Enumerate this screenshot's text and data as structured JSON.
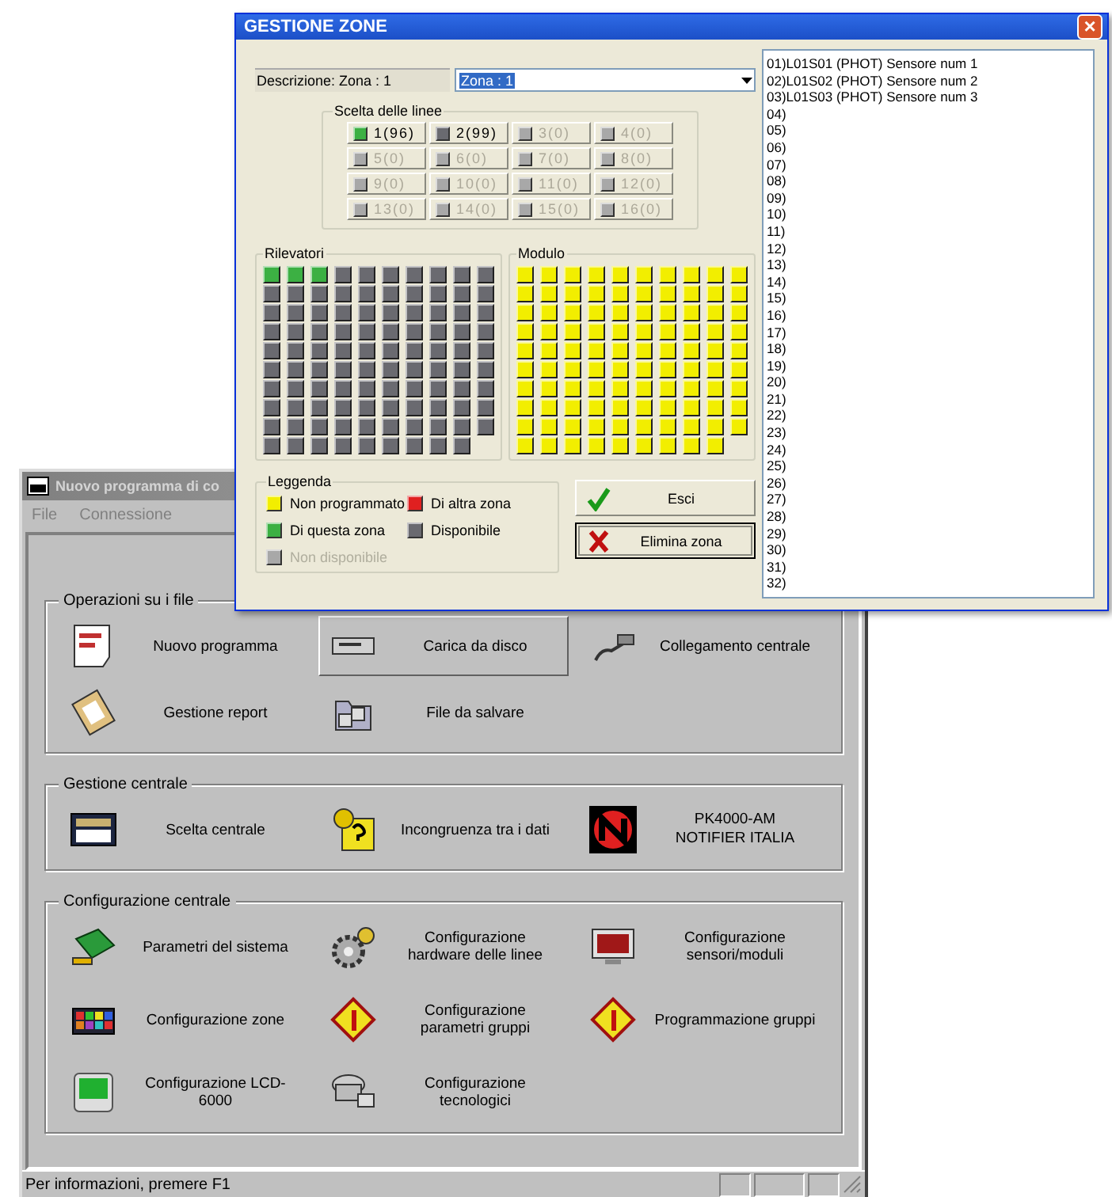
{
  "main_window": {
    "title": "Nuovo programma di co",
    "menu": [
      {
        "label": "File",
        "disabled": true
      },
      {
        "label": "Connessione",
        "disabled": true
      }
    ],
    "groups": [
      {
        "title": "Operazioni su i file",
        "items": [
          {
            "label": "Nuovo programma",
            "selected": false
          },
          {
            "label": "Carica da disco",
            "selected": true
          },
          {
            "label": "Collegamento centrale",
            "selected": false
          },
          {
            "label": "Gestione report",
            "selected": false
          },
          {
            "label": "File da salvare",
            "selected": false
          }
        ]
      },
      {
        "title": "Gestione centrale",
        "items": [
          {
            "label": "Scelta centrale",
            "selected": false
          },
          {
            "label": "Incongruenza tra i dati",
            "selected": false
          }
        ],
        "panel_model": [
          "PK4000-AM",
          "NOTIFIER ITALIA"
        ]
      },
      {
        "title": "Configurazione centrale",
        "items": [
          {
            "label": "Parametri del sistema",
            "selected": false
          },
          {
            "label": "Configurazione hardware delle linee",
            "selected": false
          },
          {
            "label": "Configurazione sensori/moduli",
            "selected": false
          },
          {
            "label": "Configurazione zone",
            "selected": false
          },
          {
            "label": "Configurazione parametri gruppi",
            "selected": false
          },
          {
            "label": "Programmazione gruppi",
            "selected": false
          },
          {
            "label": "Configurazione LCD-6000",
            "selected": false
          },
          {
            "label": "Configurazione tecnologici",
            "selected": false
          }
        ]
      }
    ],
    "status_bar": {
      "text": "Per informazioni, premere F1"
    }
  },
  "dialog": {
    "title": "GESTIONE ZONE",
    "close": "×",
    "description_label": "Descrizione: Zona : 1",
    "zone_select": {
      "value": "Zona : 1"
    },
    "lines_group": {
      "title": "Scelta delle linee",
      "lines": [
        {
          "label": "1(96)",
          "selected": true,
          "disabled": false
        },
        {
          "label": "2(99)",
          "selected": false,
          "disabled": false
        },
        {
          "label": "3(0)",
          "selected": false,
          "disabled": true
        },
        {
          "label": "4(0)",
          "selected": false,
          "disabled": true
        },
        {
          "label": "5(0)",
          "selected": false,
          "disabled": true
        },
        {
          "label": "6(0)",
          "selected": false,
          "disabled": true
        },
        {
          "label": "7(0)",
          "selected": false,
          "disabled": true
        },
        {
          "label": "8(0)",
          "selected": false,
          "disabled": true
        },
        {
          "label": "9(0)",
          "selected": false,
          "disabled": true
        },
        {
          "label": "10(0)",
          "selected": false,
          "disabled": true
        },
        {
          "label": "11(0)",
          "selected": false,
          "disabled": true
        },
        {
          "label": "12(0)",
          "selected": false,
          "disabled": true
        },
        {
          "label": "13(0)",
          "selected": false,
          "disabled": true
        },
        {
          "label": "14(0)",
          "selected": false,
          "disabled": true
        },
        {
          "label": "15(0)",
          "selected": false,
          "disabled": true
        },
        {
          "label": "16(0)",
          "selected": false,
          "disabled": true
        }
      ]
    },
    "detectors": {
      "title": "Rilevatori",
      "cells": [
        {
          "in_zone": true
        },
        {
          "in_zone": true
        },
        {
          "in_zone": true
        },
        {
          "in_zone": false
        },
        {
          "in_zone": false
        },
        {
          "in_zone": false
        },
        {
          "in_zone": false
        },
        {
          "in_zone": false
        },
        {
          "in_zone": false
        },
        {
          "in_zone": false
        },
        {
          "in_zone": false
        },
        {
          "in_zone": false
        },
        {
          "in_zone": false
        },
        {
          "in_zone": false
        },
        {
          "in_zone": false
        },
        {
          "in_zone": false
        },
        {
          "in_zone": false
        },
        {
          "in_zone": false
        },
        {
          "in_zone": false
        },
        {
          "in_zone": false
        },
        {
          "in_zone": false
        },
        {
          "in_zone": false
        },
        {
          "in_zone": false
        },
        {
          "in_zone": false
        },
        {
          "in_zone": false
        },
        {
          "in_zone": false
        },
        {
          "in_zone": false
        },
        {
          "in_zone": false
        },
        {
          "in_zone": false
        },
        {
          "in_zone": false
        },
        {
          "in_zone": false
        },
        {
          "in_zone": false
        },
        {
          "in_zone": false
        },
        {
          "in_zone": false
        },
        {
          "in_zone": false
        },
        {
          "in_zone": false
        },
        {
          "in_zone": false
        },
        {
          "in_zone": false
        },
        {
          "in_zone": false
        },
        {
          "in_zone": false
        },
        {
          "in_zone": false
        },
        {
          "in_zone": false
        },
        {
          "in_zone": false
        },
        {
          "in_zone": false
        },
        {
          "in_zone": false
        },
        {
          "in_zone": false
        },
        {
          "in_zone": false
        },
        {
          "in_zone": false
        },
        {
          "in_zone": false
        },
        {
          "in_zone": false
        },
        {
          "in_zone": false
        },
        {
          "in_zone": false
        },
        {
          "in_zone": false
        },
        {
          "in_zone": false
        },
        {
          "in_zone": false
        },
        {
          "in_zone": false
        },
        {
          "in_zone": false
        },
        {
          "in_zone": false
        },
        {
          "in_zone": false
        },
        {
          "in_zone": false
        },
        {
          "in_zone": false
        },
        {
          "in_zone": false
        },
        {
          "in_zone": false
        },
        {
          "in_zone": false
        },
        {
          "in_zone": false
        },
        {
          "in_zone": false
        },
        {
          "in_zone": false
        },
        {
          "in_zone": false
        },
        {
          "in_zone": false
        },
        {
          "in_zone": false
        },
        {
          "in_zone": false
        },
        {
          "in_zone": false
        },
        {
          "in_zone": false
        },
        {
          "in_zone": false
        },
        {
          "in_zone": false
        },
        {
          "in_zone": false
        },
        {
          "in_zone": false
        },
        {
          "in_zone": false
        },
        {
          "in_zone": false
        },
        {
          "in_zone": false
        },
        {
          "in_zone": false
        },
        {
          "in_zone": false
        },
        {
          "in_zone": false
        },
        {
          "in_zone": false
        },
        {
          "in_zone": false
        },
        {
          "in_zone": false
        },
        {
          "in_zone": false
        },
        {
          "in_zone": false
        },
        {
          "in_zone": false
        },
        {
          "in_zone": false
        },
        {
          "in_zone": false
        },
        {
          "in_zone": false
        },
        {
          "in_zone": false
        },
        {
          "in_zone": false
        },
        {
          "in_zone": false
        },
        {
          "in_zone": false
        },
        {
          "in_zone": false
        },
        {
          "in_zone": false
        },
        {
          "in_zone": false
        }
      ]
    },
    "modules": {
      "title": "Modulo",
      "cells": [
        {
          "programmed": false
        },
        {
          "programmed": false
        },
        {
          "programmed": false
        },
        {
          "programmed": false
        },
        {
          "programmed": false
        },
        {
          "programmed": false
        },
        {
          "programmed": false
        },
        {
          "programmed": false
        },
        {
          "programmed": false
        },
        {
          "programmed": false
        },
        {
          "programmed": false
        },
        {
          "programmed": false
        },
        {
          "programmed": false
        },
        {
          "programmed": false
        },
        {
          "programmed": false
        },
        {
          "programmed": false
        },
        {
          "programmed": false
        },
        {
          "programmed": false
        },
        {
          "programmed": false
        },
        {
          "programmed": false
        },
        {
          "programmed": false
        },
        {
          "programmed": false
        },
        {
          "programmed": false
        },
        {
          "programmed": false
        },
        {
          "programmed": false
        },
        {
          "programmed": false
        },
        {
          "programmed": false
        },
        {
          "programmed": false
        },
        {
          "programmed": false
        },
        {
          "programmed": false
        },
        {
          "programmed": false
        },
        {
          "programmed": false
        },
        {
          "programmed": false
        },
        {
          "programmed": false
        },
        {
          "programmed": false
        },
        {
          "programmed": false
        },
        {
          "programmed": false
        },
        {
          "programmed": false
        },
        {
          "programmed": false
        },
        {
          "programmed": false
        },
        {
          "programmed": false
        },
        {
          "programmed": false
        },
        {
          "programmed": false
        },
        {
          "programmed": false
        },
        {
          "programmed": false
        },
        {
          "programmed": false
        },
        {
          "programmed": false
        },
        {
          "programmed": false
        },
        {
          "programmed": false
        },
        {
          "programmed": false
        },
        {
          "programmed": false
        },
        {
          "programmed": false
        },
        {
          "programmed": false
        },
        {
          "programmed": false
        },
        {
          "programmed": false
        },
        {
          "programmed": false
        },
        {
          "programmed": false
        },
        {
          "programmed": false
        },
        {
          "programmed": false
        },
        {
          "programmed": false
        },
        {
          "programmed": false
        },
        {
          "programmed": false
        },
        {
          "programmed": false
        },
        {
          "programmed": false
        },
        {
          "programmed": false
        },
        {
          "programmed": false
        },
        {
          "programmed": false
        },
        {
          "programmed": false
        },
        {
          "programmed": false
        },
        {
          "programmed": false
        },
        {
          "programmed": false
        },
        {
          "programmed": false
        },
        {
          "programmed": false
        },
        {
          "programmed": false
        },
        {
          "programmed": false
        },
        {
          "programmed": false
        },
        {
          "programmed": false
        },
        {
          "programmed": false
        },
        {
          "programmed": false
        },
        {
          "programmed": false
        },
        {
          "programmed": false
        },
        {
          "programmed": false
        },
        {
          "programmed": false
        },
        {
          "programmed": false
        },
        {
          "programmed": false
        },
        {
          "programmed": false
        },
        {
          "programmed": false
        },
        {
          "programmed": false
        },
        {
          "programmed": false
        },
        {
          "programmed": false
        },
        {
          "programmed": false
        },
        {
          "programmed": false
        },
        {
          "programmed": false
        },
        {
          "programmed": false
        },
        {
          "programmed": false
        },
        {
          "programmed": false
        },
        {
          "programmed": false
        },
        {
          "programmed": false
        },
        {
          "programmed": false
        }
      ]
    },
    "legend": {
      "title": "Leggenda",
      "items": [
        {
          "label": "Non programmato",
          "color": "#f2ee00",
          "disabled": false
        },
        {
          "label": "Di altra zona",
          "color": "#e02020",
          "disabled": false
        },
        {
          "label": "Di questa zona",
          "color": "#3cb043",
          "disabled": false
        },
        {
          "label": "Disponibile",
          "color": "#6a6a70",
          "disabled": false
        },
        {
          "label": "Non disponibile",
          "color": "#a8a8a8",
          "disabled": true
        }
      ]
    },
    "buttons": [
      {
        "label": "Esci",
        "kind": "ok"
      },
      {
        "label": "Elimina zona",
        "kind": "delete"
      }
    ],
    "sensor_list": [
      "01)L01S01 (PHOT) Sensore num 1",
      "02)L01S02 (PHOT) Sensore num 2",
      "03)L01S03 (PHOT) Sensore num 3",
      "04)",
      "05)",
      "06)",
      "07)",
      "08)",
      "09)",
      "10)",
      "11)",
      "12)",
      "13)",
      "14)",
      "15)",
      "16)",
      "17)",
      "18)",
      "19)",
      "20)",
      "21)",
      "22)",
      "23)",
      "24)",
      "25)",
      "26)",
      "27)",
      "28)",
      "29)",
      "30)",
      "31)",
      "32)"
    ]
  }
}
